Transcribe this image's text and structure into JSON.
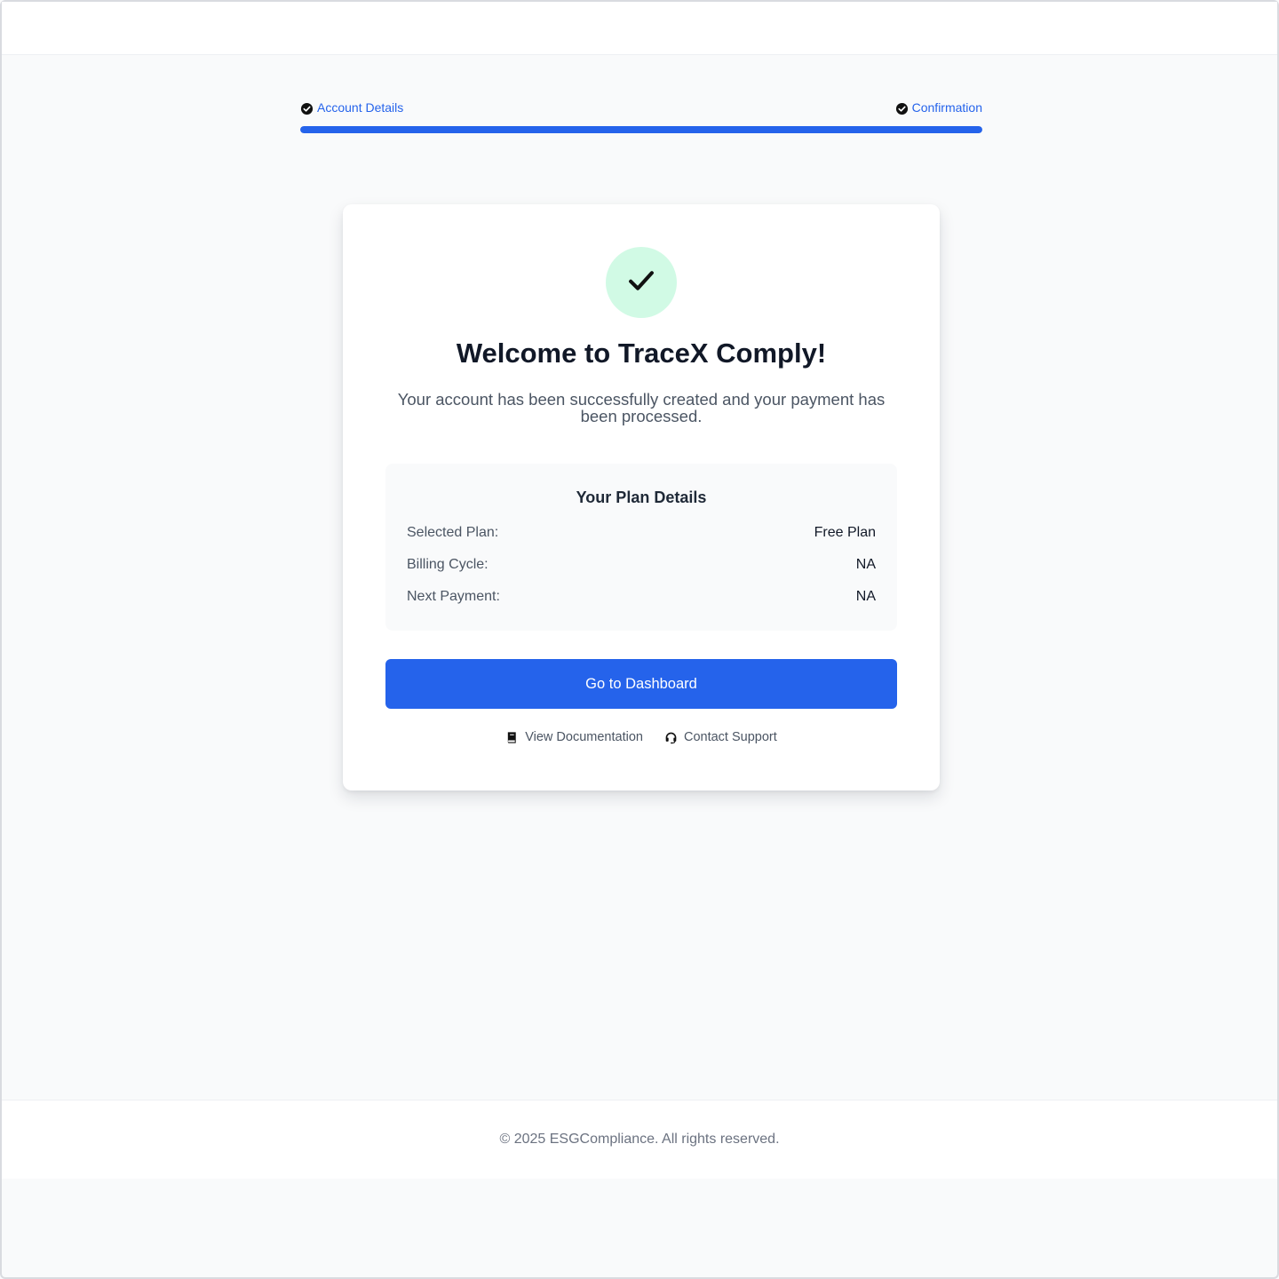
{
  "stepper": {
    "steps": [
      {
        "label": "Account Details",
        "status": "complete"
      },
      {
        "label": "Confirmation",
        "status": "complete"
      }
    ],
    "progress_fraction": 1.0
  },
  "confirmation": {
    "icon": "check-icon",
    "title": "Welcome to TraceX Comply!",
    "subtitle": "Your account has been successfully created and your payment has been processed."
  },
  "plan": {
    "heading": "Your Plan Details",
    "rows": [
      {
        "label": "Selected Plan:",
        "value": "Free Plan"
      },
      {
        "label": "Billing Cycle:",
        "value": "NA"
      },
      {
        "label": "Next Payment:",
        "value": "NA"
      }
    ]
  },
  "actions": {
    "primary_label": "Go to Dashboard",
    "links": [
      {
        "label": "View Documentation",
        "icon": "book-icon"
      },
      {
        "label": "Contact Support",
        "icon": "headset-icon"
      }
    ]
  },
  "footer": {
    "copyright": "© 2025 ESGCompliance. All rights reserved."
  },
  "colors": {
    "accent": "#2563eb",
    "success_bg": "#d1fae5",
    "page_bg": "#f9fafb"
  }
}
